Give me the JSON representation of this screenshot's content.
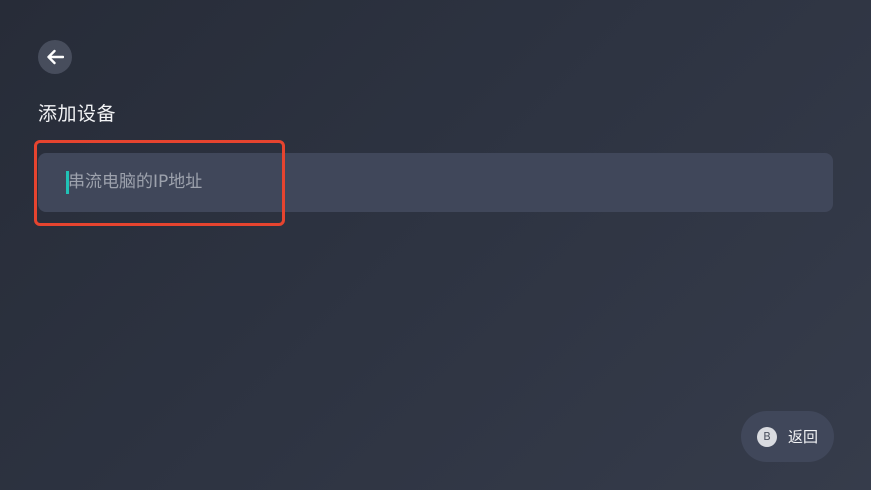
{
  "header": {
    "back_icon": "arrow-left-icon",
    "title": "添加设备"
  },
  "form": {
    "ip_input": {
      "value": "",
      "placeholder": "串流电脑的IP地址"
    },
    "focus_color": "#e6442f",
    "caret_color": "#20c2b6"
  },
  "footer": {
    "return_key": "B",
    "return_label": "返回"
  }
}
